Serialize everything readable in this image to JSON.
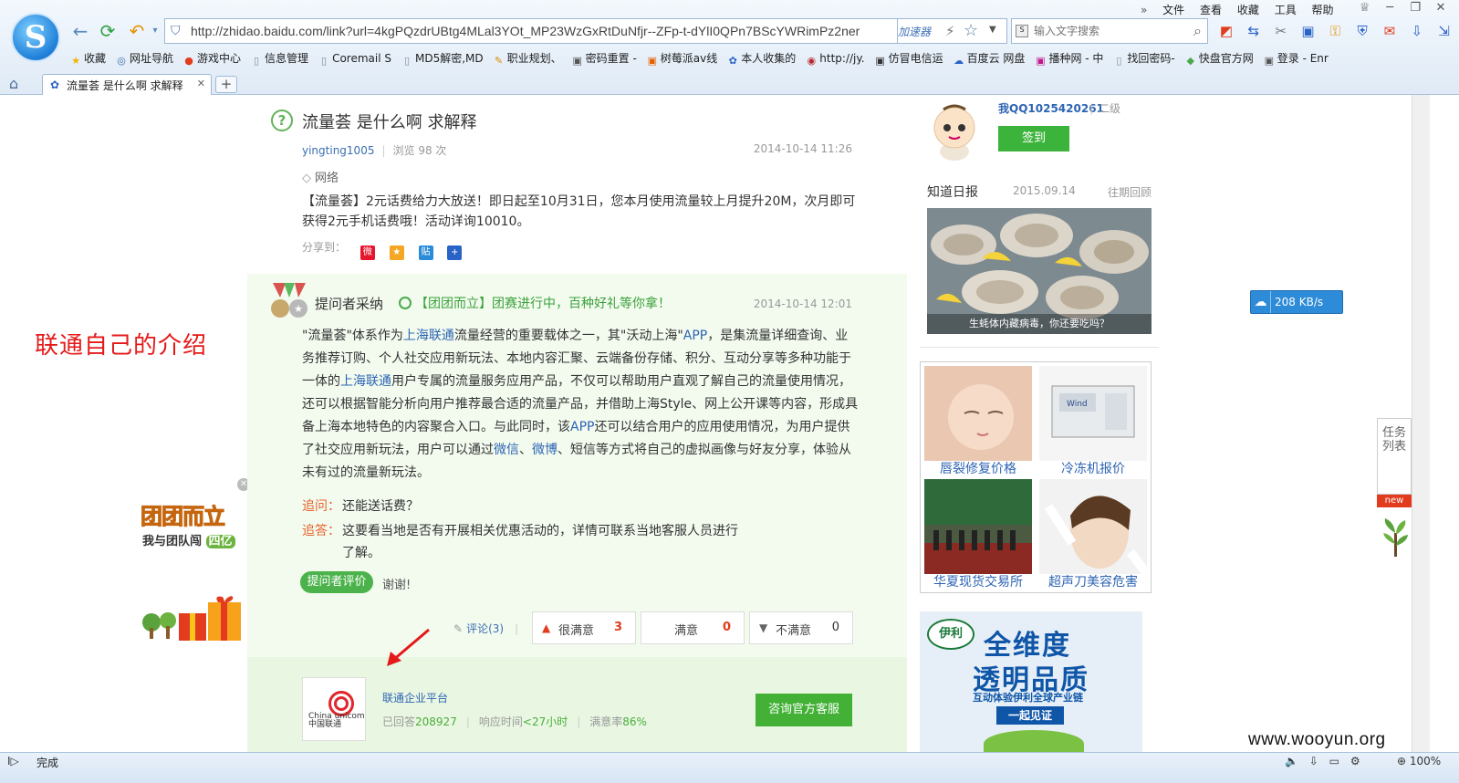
{
  "browser": {
    "url": "http://zhidao.baidu.com/link?url=4kgPQzdrUBtg4MLal3YOt_MP23WzGxRtDuNfjr--ZFp-t-dYlI0QPn7BScYWRimPz2ner",
    "accelerator_label": "加速器",
    "search_placeholder": "输入文字搜索",
    "menu": [
      "文件",
      "查看",
      "收藏",
      "工具",
      "帮助"
    ],
    "bookmarks": [
      {
        "icon": "star-icon",
        "glyph": "★",
        "color": "#f0b400",
        "label": "收藏"
      },
      {
        "icon": "globe-icon",
        "glyph": "◎",
        "color": "#3a6fb0",
        "label": "网址导航"
      },
      {
        "icon": "game-icon",
        "glyph": "●",
        "color": "#e23b1e",
        "label": "游戏中心"
      },
      {
        "icon": "page-icon",
        "glyph": "▯",
        "color": "#7a8ca0",
        "label": "信息管理"
      },
      {
        "icon": "page-icon",
        "glyph": "▯",
        "color": "#7a8ca0",
        "label": "Coremail S"
      },
      {
        "icon": "page-icon",
        "glyph": "▯",
        "color": "#7a8ca0",
        "label": "MD5解密,MD"
      },
      {
        "icon": "career-icon",
        "glyph": "✎",
        "color": "#d88b00",
        "label": "职业规划、"
      },
      {
        "icon": "site-icon",
        "glyph": "▣",
        "color": "#555",
        "label": "密码重置 -"
      },
      {
        "icon": "site-icon",
        "glyph": "▣",
        "color": "#e66000",
        "label": "树莓派av线"
      },
      {
        "icon": "paw-icon",
        "glyph": "✿",
        "color": "#2a63c8",
        "label": "本人收集的"
      },
      {
        "icon": "site-icon",
        "glyph": "◉",
        "color": "#b2282e",
        "label": "http://jy."
      },
      {
        "icon": "site-icon",
        "glyph": "▣",
        "color": "#333",
        "label": "仿冒电信运"
      },
      {
        "icon": "cloud-icon",
        "glyph": "☁",
        "color": "#2a63c8",
        "label": "百度云 网盘"
      },
      {
        "icon": "site-icon",
        "glyph": "▣",
        "color": "#c0188c",
        "label": "播种网 - 中"
      },
      {
        "icon": "page-icon",
        "glyph": "▯",
        "color": "#7a8ca0",
        "label": "找回密码-"
      },
      {
        "icon": "diamond-icon",
        "glyph": "◆",
        "color": "#4aa94a",
        "label": "快盘官方网"
      },
      {
        "icon": "site-icon",
        "glyph": "▣",
        "color": "#555",
        "label": "登录 - Enr"
      }
    ],
    "tab_title": "流量荟 是什么啊 求解释",
    "status_text": "完成",
    "zoom": "100%"
  },
  "annotation": {
    "note": "联通自己的介绍"
  },
  "float_ad": {
    "headline": "团团而立",
    "sub": "我与团队闯",
    "badge": "四亿"
  },
  "question": {
    "title": "流量荟 是什么啊 求解释",
    "user": "yingting1005",
    "views": "浏览 98 次",
    "date": "2014-10-14 11:26",
    "tag": "网络",
    "body": "【流量荟】2元话费给力大放送！即日起至10月31日，您本月使用流量较上月提升20M，次月即可获得2元手机话费哦！活动详询10010。",
    "share_label": "分享到："
  },
  "answer": {
    "title": "提问者采纳",
    "promo": "【团团而立】团赛进行中，百种好礼等你拿！",
    "date": "2014-10-14 12:01",
    "body": [
      {
        "t": "\"流量荟\"体系作为"
      },
      {
        "t": "上海联通",
        "link": true
      },
      {
        "t": "流量经营的重要载体之一，其\"沃动上海\""
      },
      {
        "t": "APP",
        "link": true
      },
      {
        "t": "，是集流量详细查询、业务推荐订购、个人社交应用新玩法、本地内容汇聚、云端备份存储、积分、互动分享等多种功能于一体的"
      },
      {
        "t": "上海联通",
        "link": true
      },
      {
        "t": "用户专属的流量服务应用产品，不仅可以帮助用户直观了解自己的流量使用情况，还可以根据智能分析向用户推荐最合适的流量产品，并借助上海Style、网上公开课等内容，形成具备上海本地特色的内容聚合入口。与此同时，该"
      },
      {
        "t": "APP",
        "link": true
      },
      {
        "t": "还可以结合用户的应用使用情况，为用户提供了社交应用新玩法，用户可以通过"
      },
      {
        "t": "微信",
        "link": true
      },
      {
        "t": "、"
      },
      {
        "t": "微博",
        "link": true
      },
      {
        "t": "、短信等方式将自己的虚拟画像与好友分享，体验从未有过的流量新玩法。"
      }
    ],
    "follow_q_label": "追问：",
    "follow_q": "还能送话费？",
    "follow_a_label": "追答：",
    "follow_a": "这要看当地是否有开展相关优惠活动的，详情可联系当地客服人员进行了解。",
    "rate_label": "提问者评价",
    "thanks": "谢谢!",
    "comment_label": "评论(3)",
    "votes": [
      {
        "label": "很满意",
        "count": "3",
        "style": "red",
        "icon": "thumbs-up-icon",
        "glyph": "👍"
      },
      {
        "label": "满意",
        "count": "0",
        "style": "red",
        "icon": "none",
        "glyph": ""
      },
      {
        "label": "不满意",
        "count": "0",
        "style": "dark",
        "icon": "thumbs-down-icon",
        "glyph": "👎"
      }
    ]
  },
  "enterprise": {
    "logo_text": "China unicom中国联通",
    "name": "联通企业平台",
    "answered_label": "已回答",
    "answered": "208927",
    "response_label": "响应时间",
    "response": "<27小时",
    "satisfaction_label": "满意率",
    "satisfaction": "86%",
    "button": "咨询官方客服"
  },
  "sidebar": {
    "username": "我QQ1025420261",
    "level": "二级",
    "signin": "签到",
    "daily_title": "知道日报",
    "daily_date": "2015.09.14",
    "daily_past": "往期回顾",
    "daily_caption": "生蚝体内藏病毒，你还要吃吗？",
    "ads": [
      "唇裂修复价格",
      "冷冻机报价",
      "华夏现货交易所",
      "超声刀美容危害"
    ],
    "yili_brand": "伊利",
    "yili_h1": "全维度",
    "yili_h2": "透明品质",
    "yili_h3": "互动体验伊利全球产业链",
    "yili_btn": "一起见证"
  },
  "speed_widget": "208 KB/s",
  "task_panel": {
    "label": "任务列表",
    "badge": "new"
  },
  "watermark": "www.wooyun.org"
}
